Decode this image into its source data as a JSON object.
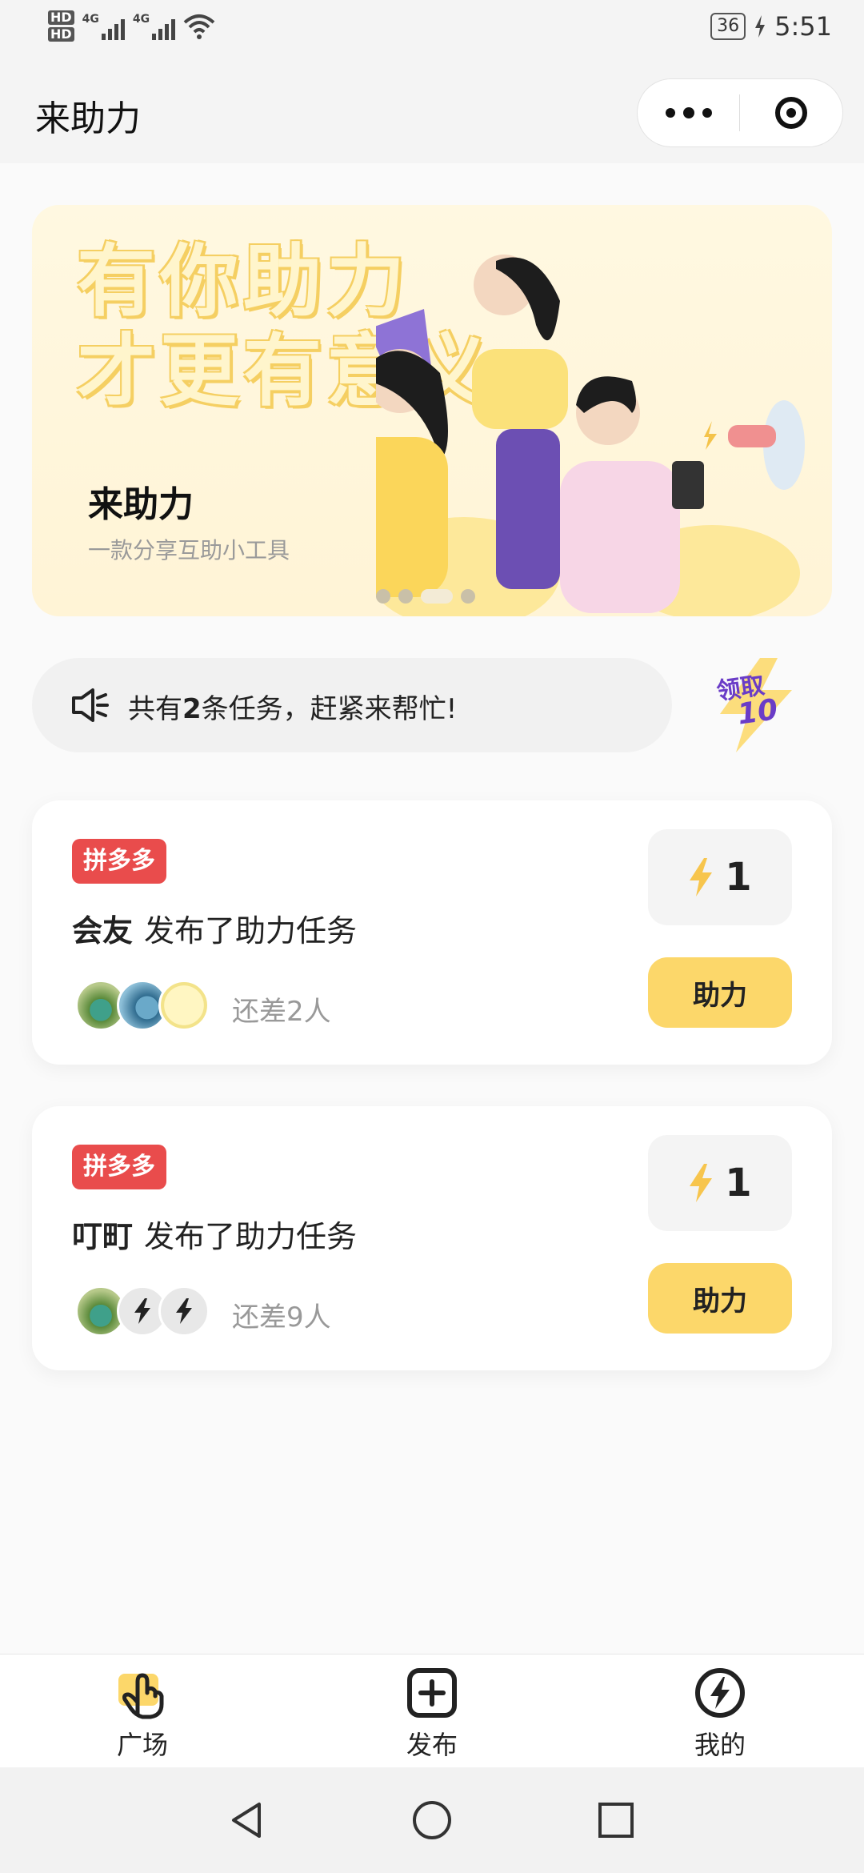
{
  "status_bar": {
    "hd1": "HD",
    "hd2": "HD",
    "net1": "4G",
    "net2": "4G",
    "battery": "36",
    "time": "5:51"
  },
  "header": {
    "title": "来助力"
  },
  "banner": {
    "slogan_line1": "有你助力",
    "slogan_line2": "才更有意义",
    "title": "来助力",
    "subtitle": "一款分享互助小工具",
    "slide_count": 4,
    "active_slide": 3
  },
  "notice": {
    "prefix": "共有",
    "count": "2",
    "suffix": "条任务，赶紧来帮忙!"
  },
  "reward": {
    "line1": "领取",
    "line2": "10"
  },
  "tasks": [
    {
      "platform": "拼多多",
      "user": "会友",
      "action": "发布了助力任务",
      "remaining": "还差2人",
      "points": "1",
      "button": "助力"
    },
    {
      "platform": "拼多多",
      "user": "叮町",
      "action": "发布了助力任务",
      "remaining": "还差9人",
      "points": "1",
      "button": "助力"
    }
  ],
  "tabbar": {
    "items": [
      {
        "label": "广场",
        "icon": "hand-pointer-icon"
      },
      {
        "label": "发布",
        "icon": "plus-square-icon"
      },
      {
        "label": "我的",
        "icon": "lightning-circle-icon"
      }
    ]
  },
  "colors": {
    "accent": "#fcd76a",
    "tag_red": "#e94c4c",
    "banner_bg": "#fff6dc"
  }
}
